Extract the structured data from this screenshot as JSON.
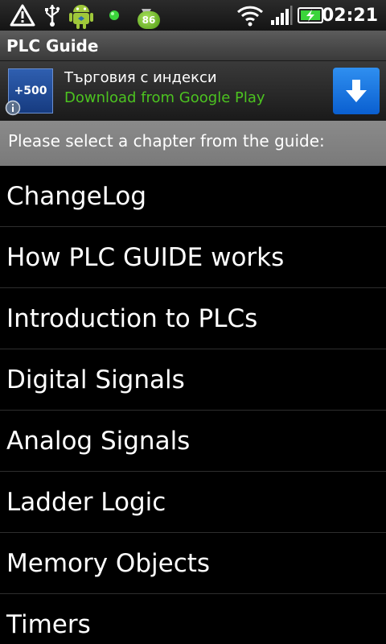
{
  "status_bar": {
    "time": "02:21",
    "badge_count": "86",
    "icons": [
      "warning-icon",
      "usb-icon",
      "android-robot-icon",
      "notification-dot-icon",
      "wifi-icon",
      "signal-icon",
      "battery-charging-icon"
    ]
  },
  "app": {
    "title": "PLC Guide"
  },
  "ad": {
    "logo_text": "+500",
    "title": "Търговия с индекси",
    "subtitle": "Download from Google Play",
    "colors": {
      "subtitle": "#4cc320",
      "button": "#0a5fd0"
    }
  },
  "prompt": "Please select a chapter from the guide:",
  "chapters": [
    "ChangeLog",
    "How PLC GUIDE works",
    "Introduction to PLCs",
    "Digital Signals",
    "Analog Signals",
    "Ladder Logic",
    "Memory Objects",
    "Timers"
  ]
}
